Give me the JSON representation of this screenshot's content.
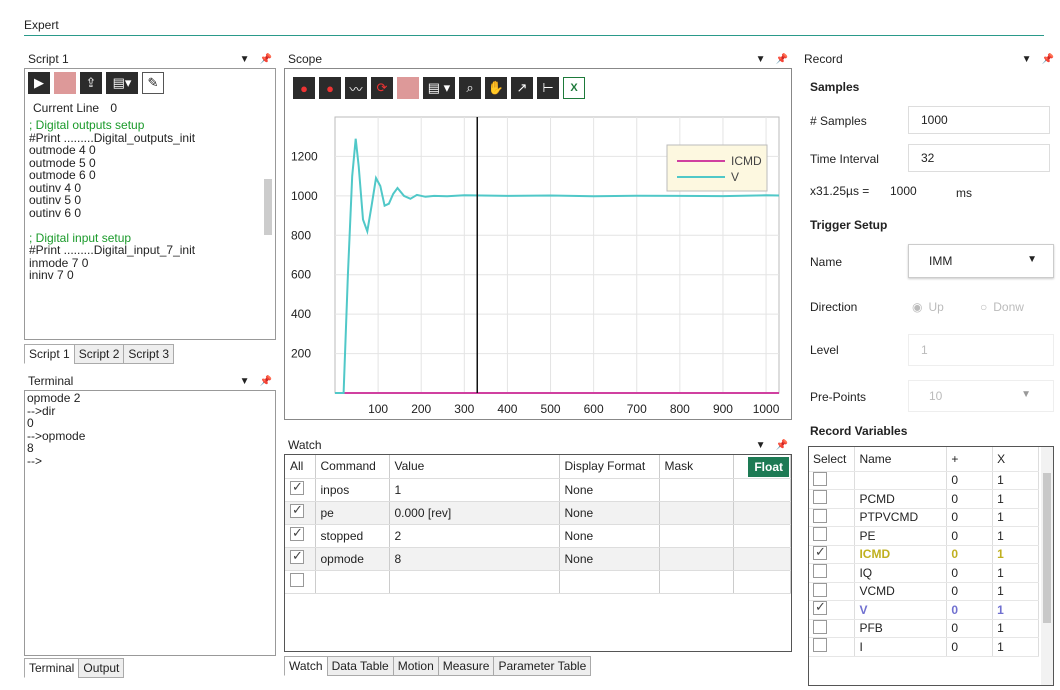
{
  "app": {
    "title": "Expert"
  },
  "script": {
    "title": "Script 1",
    "current_line_label": "Current Line",
    "current_line_value": "0",
    "lines": [
      {
        "text": "; Digital outputs setup",
        "comment": true
      },
      {
        "text": "#Print .........Digital_outputs_init",
        "comment": false
      },
      {
        "text": "outmode 4 0",
        "comment": false
      },
      {
        "text": "outmode 5 0",
        "comment": false
      },
      {
        "text": "outmode 6 0",
        "comment": false
      },
      {
        "text": "outinv 4 0",
        "comment": false
      },
      {
        "text": "outinv 5 0",
        "comment": false
      },
      {
        "text": "outinv 6 0",
        "comment": false
      },
      {
        "text": "",
        "comment": false
      },
      {
        "text": "; Digital input setup",
        "comment": true
      },
      {
        "text": "#Print .........Digital_input_7_init",
        "comment": false
      },
      {
        "text": "inmode 7 0",
        "comment": false
      },
      {
        "text": "ininv 7 0",
        "comment": false
      }
    ],
    "tabs": [
      "Script 1",
      "Script 2",
      "Script 3"
    ]
  },
  "terminal": {
    "title": "Terminal",
    "lines": [
      "opmode 2",
      "-->dir",
      "0",
      "-->opmode",
      "8",
      "-->"
    ],
    "tabs": [
      "Terminal",
      "Output"
    ]
  },
  "scope": {
    "title": "Scope",
    "legend": [
      {
        "name": "ICMD",
        "color": "#d040a0"
      },
      {
        "name": "V",
        "color": "#50c8c8"
      }
    ],
    "x_ticks": [
      "100",
      "200",
      "300",
      "400",
      "500",
      "600",
      "700",
      "800",
      "900",
      "1000"
    ],
    "y_ticks": [
      "1200",
      "1000",
      "800",
      "600",
      "400",
      "200"
    ]
  },
  "chart_data": {
    "type": "line",
    "xlim": [
      0,
      1030
    ],
    "ylim": [
      0,
      1400
    ],
    "series": [
      {
        "name": "ICMD",
        "color": "#d040a0",
        "x": [
          0,
          1030
        ],
        "y": [
          0,
          0
        ]
      },
      {
        "name": "V",
        "color": "#50c8c8",
        "x": [
          0,
          20,
          30,
          40,
          48,
          55,
          65,
          75,
          85,
          95,
          105,
          115,
          125,
          135,
          145,
          160,
          175,
          190,
          210,
          230,
          260,
          300,
          400,
          500,
          600,
          700,
          800,
          900,
          1000,
          1030
        ],
        "y": [
          0,
          0,
          600,
          1100,
          1290,
          1150,
          880,
          820,
          950,
          1090,
          1050,
          950,
          960,
          1010,
          1040,
          1000,
          985,
          1005,
          995,
          1000,
          998,
          1003,
          1000,
          1002,
          998,
          1001,
          1000,
          999,
          1003,
          1002
        ]
      }
    ]
  },
  "cursor_x": 330,
  "watch": {
    "title": "Watch",
    "float_label": "Float",
    "headers": [
      "All",
      "Command",
      "Value",
      "Display Format",
      "Mask"
    ],
    "rows": [
      {
        "checked": true,
        "command": "inpos",
        "value": "1",
        "format": "None",
        "mask": ""
      },
      {
        "checked": true,
        "command": "pe",
        "value": "0.000 [rev]",
        "format": "None",
        "mask": ""
      },
      {
        "checked": true,
        "command": "stopped",
        "value": "2",
        "format": "None",
        "mask": ""
      },
      {
        "checked": true,
        "command": "opmode",
        "value": "8",
        "format": "None",
        "mask": ""
      },
      {
        "checked": false,
        "command": "",
        "value": "",
        "format": "",
        "mask": ""
      }
    ],
    "tabs": [
      "Watch",
      "Data Table",
      "Motion",
      "Measure",
      "Parameter Table"
    ]
  },
  "record": {
    "title": "Record",
    "samples_heading": "Samples",
    "num_samples_label": "# Samples",
    "num_samples_value": "1000",
    "time_interval_label": "Time Interval",
    "time_interval_value": "32",
    "calc_label": "x31.25µs =",
    "calc_value": "1000",
    "calc_unit": "ms",
    "trigger_heading": "Trigger Setup",
    "name_label": "Name",
    "name_value": "IMM",
    "direction_label": "Direction",
    "dir_up": "Up",
    "dir_down": "Donw",
    "level_label": "Level",
    "level_value": "1",
    "prepoints_label": "Pre-Points",
    "prepoints_value": "10",
    "vars_heading": "Record Variables",
    "vars_headers": [
      "Select",
      "Name",
      "+",
      "X"
    ],
    "vars": [
      {
        "checked": false,
        "name": "",
        "plus": "0",
        "x": "1",
        "color": ""
      },
      {
        "checked": false,
        "name": "PCMD",
        "plus": "0",
        "x": "1",
        "color": ""
      },
      {
        "checked": false,
        "name": "PTPVCMD",
        "plus": "0",
        "x": "1",
        "color": ""
      },
      {
        "checked": false,
        "name": "PE",
        "plus": "0",
        "x": "1",
        "color": ""
      },
      {
        "checked": true,
        "name": "ICMD",
        "plus": "0",
        "x": "1",
        "color": "#c0b020"
      },
      {
        "checked": false,
        "name": "IQ",
        "plus": "0",
        "x": "1",
        "color": ""
      },
      {
        "checked": false,
        "name": "VCMD",
        "plus": "0",
        "x": "1",
        "color": ""
      },
      {
        "checked": true,
        "name": "V",
        "plus": "0",
        "x": "1",
        "color": "#7070d0"
      },
      {
        "checked": false,
        "name": "PFB",
        "plus": "0",
        "x": "1",
        "color": ""
      },
      {
        "checked": false,
        "name": "I",
        "plus": "0",
        "x": "1",
        "color": ""
      }
    ]
  }
}
